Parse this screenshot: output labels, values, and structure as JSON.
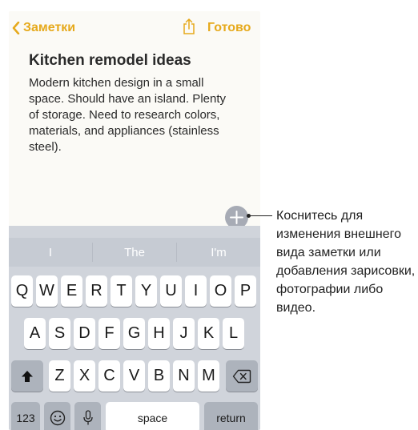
{
  "nav": {
    "back_label": "Заметки",
    "done_label": "Готово"
  },
  "note": {
    "title": "Kitchen remodel ideas",
    "body": "Modern kitchen design in a small space. Should have an island. Plenty of storage. Need to research colors, materials, and appliances (stainless steel)."
  },
  "keyboard": {
    "predictions": [
      "I",
      "The",
      "I'm"
    ],
    "row1": [
      "Q",
      "W",
      "E",
      "R",
      "T",
      "Y",
      "U",
      "I",
      "O",
      "P"
    ],
    "row2": [
      "A",
      "S",
      "D",
      "F",
      "G",
      "H",
      "J",
      "K",
      "L"
    ],
    "row3": [
      "Z",
      "X",
      "C",
      "V",
      "B",
      "N",
      "M"
    ],
    "numbers_label": "123",
    "space_label": "space",
    "return_label": "return"
  },
  "callout": {
    "text": "Коснитесь для изменения внешнего вида заметки или добавления зарисовки, фотографии либо видео."
  },
  "colors": {
    "accent": "#e6a91b",
    "note_bg": "#fbfaf6",
    "keyboard_bg": "#d0d4db"
  }
}
